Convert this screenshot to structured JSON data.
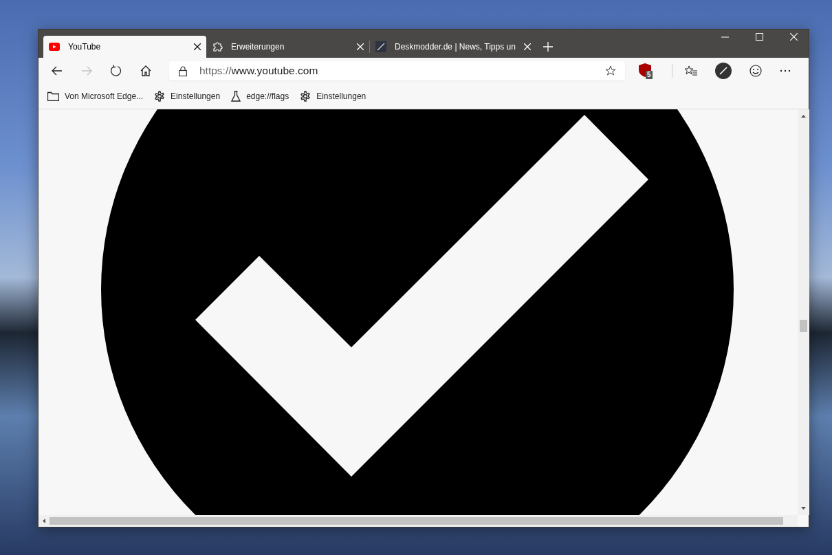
{
  "tabs": [
    {
      "kind": "video",
      "title": "YouTube",
      "selected": true
    },
    {
      "kind": "puzzle",
      "title": "Erweiterungen",
      "selected": false
    },
    {
      "kind": "site",
      "title": "Deskmodder.de | News, Tipps un",
      "selected": false
    }
  ],
  "nav_buttons": [
    {
      "kind": "back",
      "disabled": false
    },
    {
      "kind": "forward",
      "disabled": true
    },
    {
      "kind": "refresh",
      "disabled": false
    },
    {
      "kind": "home",
      "disabled": false
    }
  ],
  "address": {
    "scheme": "https://",
    "host": "www.youtube.com"
  },
  "extension_badge": "5",
  "bookmarks": [
    {
      "kind": "folder",
      "label": "Von Microsoft Edge..."
    },
    {
      "kind": "gear",
      "label": "Einstellungen"
    },
    {
      "kind": "flask",
      "label": "edge://flags"
    },
    {
      "kind": "gear",
      "label": "Einstellungen"
    }
  ]
}
